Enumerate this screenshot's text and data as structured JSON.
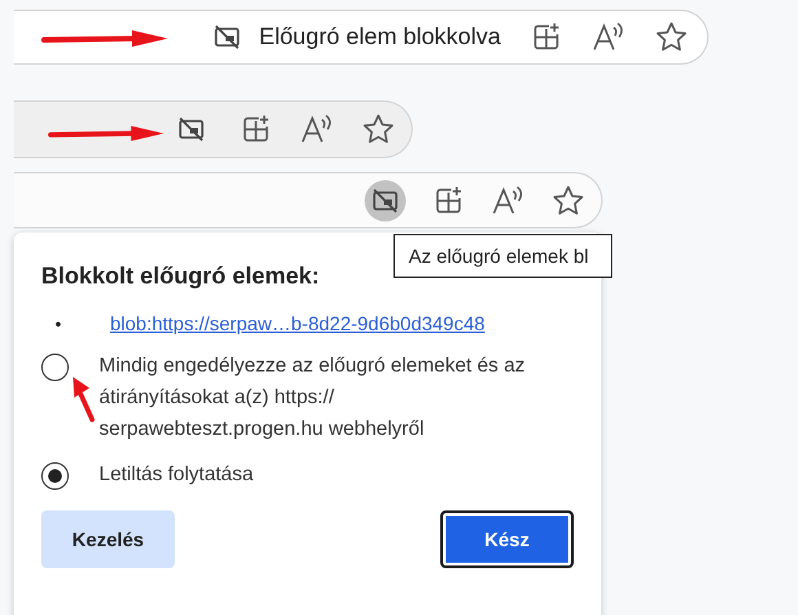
{
  "address_bars": [
    {
      "blocked_label": "Előugró elem blokkolva",
      "blocked_highlighted": false,
      "annotated": true
    },
    {
      "blocked_highlighted": false,
      "annotated": true
    },
    {
      "blocked_highlighted": true,
      "annotated": false
    }
  ],
  "tooltip": {
    "text": "Az előugró elemek bl"
  },
  "popup": {
    "title": "Blokkolt előugró elemek:",
    "links": [
      {
        "bullet": "•",
        "url": "blob:https://serpaw…b-8d22-9d6b0d349c48"
      }
    ],
    "options": [
      {
        "label": "Mindig engedélyezze az előugró elemeket és az átirányításokat a(z) https:// serpawebteszt.progen.hu webhelyről",
        "selected": false
      },
      {
        "label": "Letiltás folytatása",
        "selected": true
      }
    ],
    "buttons": [
      {
        "label": "Kezelés",
        "kind": "secondary"
      },
      {
        "label": "Kész",
        "kind": "primary"
      }
    ]
  }
}
